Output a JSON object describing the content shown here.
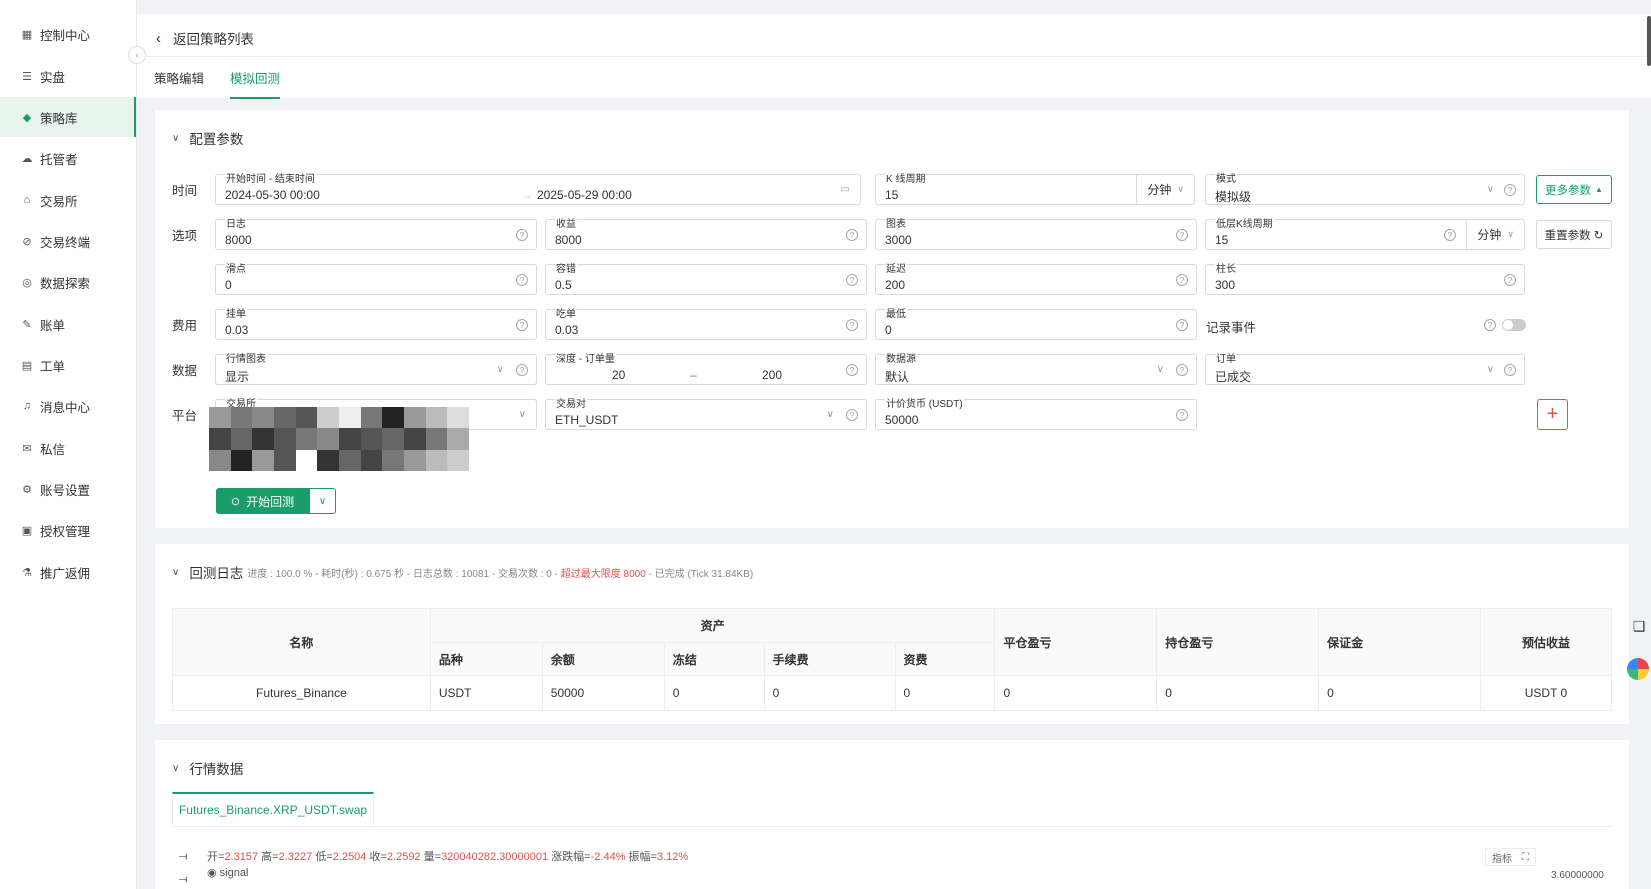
{
  "sidebar": {
    "items": [
      {
        "label": "控制中心",
        "icon": "dashboard-icon",
        "glyph": "▦"
      },
      {
        "label": "实盘",
        "icon": "list-icon",
        "glyph": "☰"
      },
      {
        "label": "策略库",
        "icon": "strategy-icon",
        "glyph": "◆"
      },
      {
        "label": "托管者",
        "icon": "cloud-icon",
        "glyph": "☁"
      },
      {
        "label": "交易所",
        "icon": "bank-icon",
        "glyph": "⌂"
      },
      {
        "label": "交易终端",
        "icon": "terminal-icon",
        "glyph": "⊘"
      },
      {
        "label": "数据探索",
        "icon": "explore-icon",
        "glyph": "◎"
      },
      {
        "label": "账单",
        "icon": "bill-icon",
        "glyph": "✎"
      },
      {
        "label": "工单",
        "icon": "ticket-icon",
        "glyph": "▤"
      },
      {
        "label": "消息中心",
        "icon": "bell-icon",
        "glyph": "♫"
      },
      {
        "label": "私信",
        "icon": "mail-icon",
        "glyph": "✉"
      },
      {
        "label": "账号设置",
        "icon": "gear-icon",
        "glyph": "⚙"
      },
      {
        "label": "授权管理",
        "icon": "auth-icon",
        "glyph": "▣"
      },
      {
        "label": "推广返佣",
        "icon": "gift-icon",
        "glyph": "⚗"
      }
    ],
    "active_index": 2
  },
  "header": {
    "back_label": "返回策略列表",
    "tabs": [
      "策略编辑",
      "模拟回测"
    ],
    "active_tab": 1
  },
  "config": {
    "title": "配置参数",
    "rows": {
      "time": "时间",
      "options": "选项",
      "fees": "费用",
      "data": "数据",
      "platform": "平台"
    },
    "time_range": {
      "label": "开始时间 - 结束时间",
      "start": "2024-05-30 00:00",
      "end": "2025-05-29 00:00"
    },
    "kline_period": {
      "label": "K 线周期",
      "value": "15",
      "unit": "分钟"
    },
    "mode": {
      "label": "模式",
      "value": "模拟级"
    },
    "more_params": "更多参数",
    "reset_params": "重置参数",
    "log": {
      "label": "日志",
      "value": "8000"
    },
    "profit": {
      "label": "收益",
      "value": "8000"
    },
    "chart": {
      "label": "图表",
      "value": "3000"
    },
    "low_kline": {
      "label": "低层K线周期",
      "value": "15",
      "unit": "分钟"
    },
    "slippage": {
      "label": "滑点",
      "value": "0"
    },
    "tolerance": {
      "label": "容错",
      "value": "0.5"
    },
    "delay": {
      "label": "延迟",
      "value": "200"
    },
    "bar_length": {
      "label": "柱长",
      "value": "300"
    },
    "maker": {
      "label": "挂单",
      "value": "0.03"
    },
    "taker": {
      "label": "吃单",
      "value": "0.03"
    },
    "min_fee": {
      "label": "最低",
      "value": "0"
    },
    "record_events": "记录事件",
    "market_chart": {
      "label": "行情图表",
      "value": "显示"
    },
    "depth": {
      "label": "深度 - 订单量",
      "from": "20",
      "to": "200"
    },
    "data_source": {
      "label": "数据源",
      "value": "默认"
    },
    "orders": {
      "label": "订单",
      "value": "已成交"
    },
    "exchange": {
      "label": "交易所"
    },
    "pair": {
      "label": "交易对",
      "value": "ETH_USDT"
    },
    "quote": {
      "label": "计价货币 (USDT)",
      "value": "50000"
    },
    "start_button": "开始回测"
  },
  "backtest_log": {
    "title": "回测日志",
    "stats_prefix": "进度 : 100.0 % - 耗时(秒) : 0.675  秒 - 日志总数 : 10081 - 交易次数 : 0 - ",
    "stats_warn": "超过最大限度 8000",
    "stats_suffix": " - 已完成 (Tick 31.84KB)",
    "table": {
      "group_header": "资产",
      "headers": {
        "name": "名称",
        "symbol": "品种",
        "balance": "余额",
        "frozen": "冻结",
        "fee": "手续费",
        "funding": "资费",
        "closed_pnl": "平仓盈亏",
        "position_pnl": "持仓盈亏",
        "margin": "保证金",
        "est_profit": "预估收益"
      },
      "rows": [
        {
          "name": "Futures_Binance",
          "symbol": "USDT",
          "balance": "50000",
          "frozen": "0",
          "fee": "0",
          "funding": "0",
          "closed_pnl": "0",
          "position_pnl": "0",
          "margin": "0",
          "est_profit": "USDT 0"
        }
      ]
    }
  },
  "market": {
    "title": "行情数据",
    "tab": "Futures_Binance.XRP_USDT.swap",
    "ohlc": {
      "open_label": "开=",
      "open": "2.3157",
      "high_label": "高=",
      "high": "2.3227",
      "low_label": "低=",
      "low": "2.2504",
      "close_label": "收=",
      "close": "2.2592",
      "vol_label": "量=",
      "vol": "320040282.30000001",
      "chg_label": "涨跌幅=",
      "chg": "-2.44%",
      "amp_label": "振幅=",
      "amp": "3.12%"
    },
    "signal": "signal",
    "indicator_button": "指标",
    "price_tick": "3.60000000"
  },
  "colors": {
    "accent": "#1a9d6a",
    "warn": "#d9534f"
  }
}
